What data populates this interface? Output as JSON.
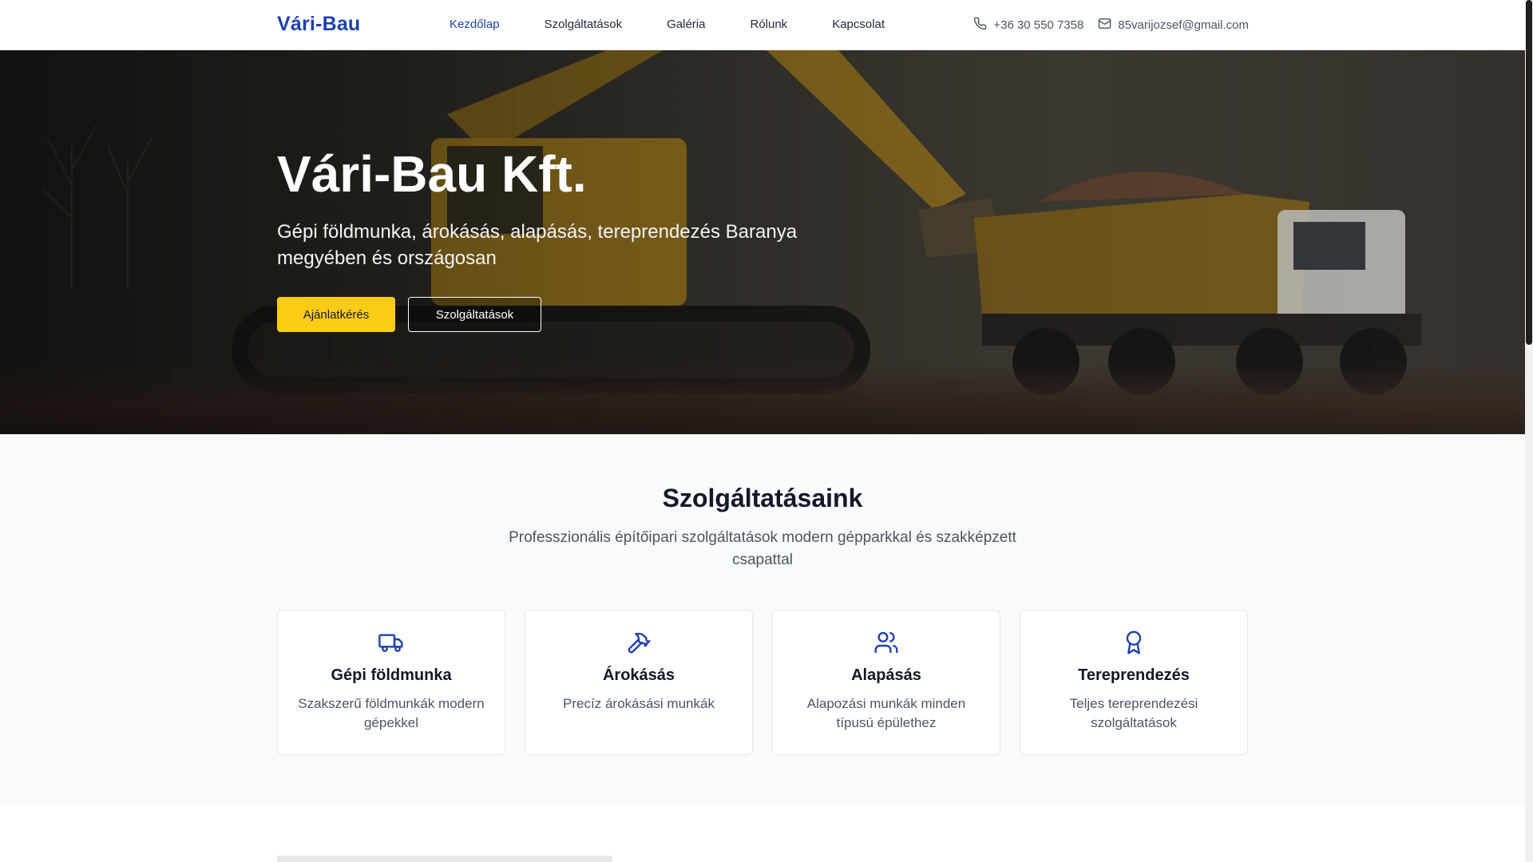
{
  "header": {
    "logo": "Vári-Bau",
    "nav": [
      {
        "label": "Kezdőlap",
        "active": true
      },
      {
        "label": "Szolgáltatások",
        "active": false
      },
      {
        "label": "Galéria",
        "active": false
      },
      {
        "label": "Rólunk",
        "active": false
      },
      {
        "label": "Kapcsolat",
        "active": false
      }
    ],
    "phone": "+36 30 550 7358",
    "email": "85varijozsef@gmail.com",
    "icons": {
      "phone": "phone-icon",
      "email": "mail-icon"
    }
  },
  "hero": {
    "title": "Vári-Bau Kft.",
    "subtitle": "Gépi földmunka, árokásás, alapásás, tereprendezés Baranya megyében és országosan",
    "primary_button": "Ajánlatkérés",
    "secondary_button": "Szolgáltatások"
  },
  "services": {
    "title": "Szolgáltatásaink",
    "subtitle": "Professzionális építőipari szolgáltatások modern gépparkkal és szakképzett csapattal",
    "cards": [
      {
        "icon": "truck-icon",
        "title": "Gépi földmunka",
        "description": "Szakszerű földmunkák modern gépekkel"
      },
      {
        "icon": "hammer-icon",
        "title": "Árokásás",
        "description": "Precíz árokásási munkák"
      },
      {
        "icon": "users-icon",
        "title": "Alapásás",
        "description": "Alapozási munkák minden típusú épülethez"
      },
      {
        "icon": "award-icon",
        "title": "Tereprendezés",
        "description": "Teljes tereprendezési szolgáltatások"
      }
    ]
  },
  "colors": {
    "brand": "#1e40af",
    "accent": "#facc15"
  }
}
